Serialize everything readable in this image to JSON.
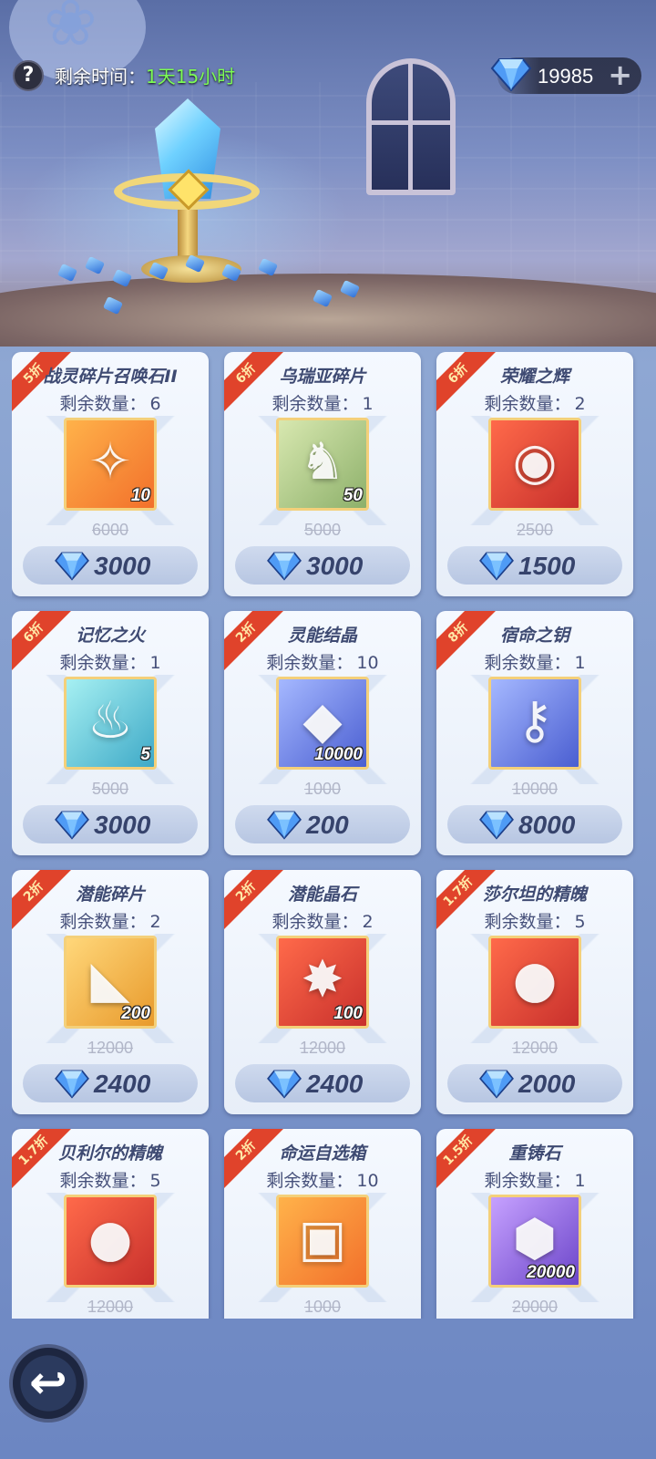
{
  "header": {
    "help_label": "?",
    "time_label": "剩余时间：",
    "time_value": "1天15小时",
    "currency_amount": "19985",
    "currency_icon": "diamond-icon",
    "add_label": "+"
  },
  "shop": {
    "stock_label": "剩余数量：",
    "currency_icon": "diamond-icon",
    "items": [
      {
        "discount": "5折",
        "name": "战灵碎片召唤石II",
        "stock": "6",
        "qty": "10",
        "old_price": "6000",
        "price": "3000",
        "icon": "summon-stone-icon",
        "glyph": "✧",
        "bg": "bg-orange"
      },
      {
        "discount": "6折",
        "name": "乌瑞亚碎片",
        "stock": "1",
        "qty": "50",
        "old_price": "5000",
        "price": "3000",
        "icon": "hero-fragment-icon",
        "glyph": "♞",
        "bg": "bg-green"
      },
      {
        "discount": "6折",
        "name": "荣耀之辉",
        "stock": "2",
        "qty": "",
        "old_price": "2500",
        "price": "1500",
        "icon": "glory-orb-icon",
        "glyph": "◉",
        "bg": "bg-red"
      },
      {
        "discount": "6折",
        "name": "记忆之火",
        "stock": "1",
        "qty": "5",
        "old_price": "5000",
        "price": "3000",
        "icon": "memory-flame-icon",
        "glyph": "♨",
        "bg": "bg-cyan"
      },
      {
        "discount": "2折",
        "name": "灵能结晶",
        "stock": "10",
        "qty": "10000",
        "old_price": "1000",
        "price": "200",
        "icon": "psionic-crystal-icon",
        "glyph": "◆",
        "bg": "bg-blue"
      },
      {
        "discount": "8折",
        "name": "宿命之钥",
        "stock": "1",
        "qty": "",
        "old_price": "10000",
        "price": "8000",
        "icon": "fate-key-icon",
        "glyph": "⚷",
        "bg": "bg-blue"
      },
      {
        "discount": "2折",
        "name": "潜能碎片",
        "stock": "2",
        "qty": "200",
        "old_price": "12000",
        "price": "2400",
        "icon": "potential-fragment-icon",
        "glyph": "◣",
        "bg": "bg-gold"
      },
      {
        "discount": "2折",
        "name": "潜能晶石",
        "stock": "2",
        "qty": "100",
        "old_price": "12000",
        "price": "2400",
        "icon": "potential-crystal-icon",
        "glyph": "✸",
        "bg": "bg-red"
      },
      {
        "discount": "1.7折",
        "name": "莎尔坦的精魄",
        "stock": "5",
        "qty": "",
        "old_price": "12000",
        "price": "2000",
        "icon": "soul-orb-purple-icon",
        "glyph": "●",
        "bg": "bg-red"
      },
      {
        "discount": "1.7折",
        "name": "贝利尔的精魄",
        "stock": "5",
        "qty": "",
        "old_price": "12000",
        "price": "",
        "icon": "soul-orb-red-icon",
        "glyph": "●",
        "bg": "bg-red"
      },
      {
        "discount": "2折",
        "name": "命运自选箱",
        "stock": "10",
        "qty": "",
        "old_price": "1000",
        "price": "",
        "icon": "fate-chest-icon",
        "glyph": "▣",
        "bg": "bg-orange"
      },
      {
        "discount": "1.5折",
        "name": "重铸石",
        "stock": "1",
        "qty": "20000",
        "old_price": "20000",
        "price": "",
        "icon": "reforge-stone-icon",
        "glyph": "⬢",
        "bg": "bg-purple"
      }
    ]
  },
  "footer": {
    "back_label": "↩"
  }
}
